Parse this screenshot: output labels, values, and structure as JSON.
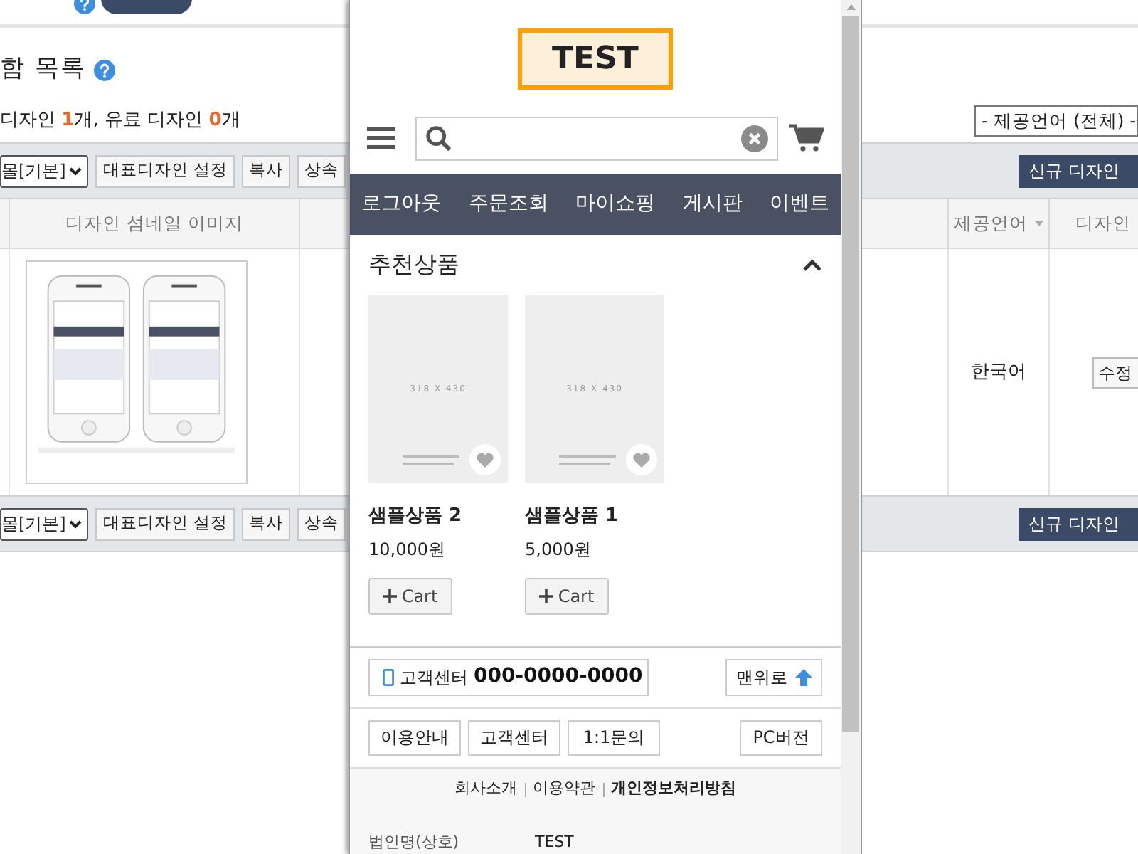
{
  "background_page": {
    "section_title": "함 목록",
    "summary": {
      "prefix": "디자인 ",
      "free_count": "1",
      "middle": "개, 유료 디자인 ",
      "paid_count": "0",
      "suffix": "개"
    },
    "language_filter": "- 제공언어 (전체) -",
    "toolbars": [
      {
        "shop_select": "몰[기본]",
        "buttons": [
          "대표디자인 설정",
          "복사",
          "상속"
        ],
        "add_button": "신규 디자인"
      },
      {
        "shop_select": "몰[기본]",
        "buttons": [
          "대표디자인 설정",
          "복사",
          "상속"
        ],
        "add_button": "신규 디자인"
      }
    ],
    "table": {
      "columns": [
        "디자인 섬네일 이미지",
        "제공언어",
        "디자인 "
      ],
      "rows": [
        {
          "language": "한국어",
          "action": "수정"
        }
      ]
    }
  },
  "preview": {
    "logo": "TEST",
    "nav": [
      "로그아웃",
      "주문조회",
      "마이쇼핑",
      "게시판",
      "이벤트"
    ],
    "section": {
      "title": "추천상품",
      "expanded": true
    },
    "products": [
      {
        "name": "샘플상품 2",
        "price": "10,000원",
        "image_label": "318 X 430",
        "cart": "Cart"
      },
      {
        "name": "샘플상품 1",
        "price": "5,000원",
        "image_label": "318 X 430",
        "cart": "Cart"
      }
    ],
    "contact": {
      "label": "고객센터",
      "phone": "000-0000-0000"
    },
    "top_button": "맨위로",
    "links": [
      "이용안내",
      "고객센터",
      "1:1문의"
    ],
    "pc_button": "PC버전",
    "footer_links": [
      {
        "label": "회사소개",
        "bold": false
      },
      {
        "label": "이용약관",
        "bold": false
      },
      {
        "label": "개인정보처리방침",
        "bold": true
      }
    ],
    "company": [
      {
        "label": "법인명(상호)",
        "value": "TEST"
      }
    ]
  }
}
